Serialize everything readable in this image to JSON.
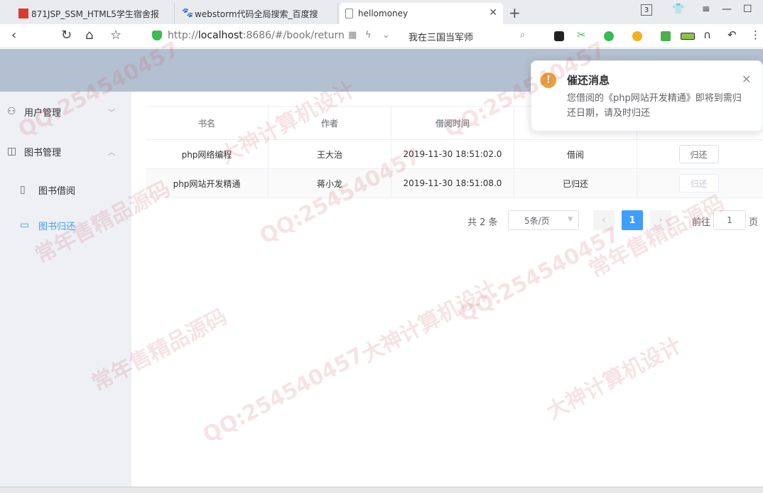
{
  "browser": {
    "tabs": [
      {
        "title": "871JSP_SSM_HTML5学生宿舍报",
        "icon": "red-square-icon"
      },
      {
        "title": "webstorm代码全局搜索_百度搜",
        "icon": "baidu-paw-icon"
      },
      {
        "title": "hellomoney",
        "icon": "page-icon"
      }
    ],
    "tab_count_badge": "3",
    "url_prefix": "http://",
    "url_host": "localhost",
    "url_rest": ":8686/#/book/return",
    "search_text": "我在三国当军师"
  },
  "sidebar": {
    "items": [
      {
        "label": "用户管理",
        "icon": "user-icon",
        "arrow": "chevron-down-icon"
      },
      {
        "label": "图书管理",
        "icon": "book-icon",
        "arrow": "chevron-up-icon"
      },
      {
        "label": "图书借阅",
        "icon": "book-open-icon"
      },
      {
        "label": "图书归还",
        "icon": "book-return-icon"
      }
    ]
  },
  "table": {
    "headers": [
      "书名",
      "作者",
      "借阅时间",
      "",
      ""
    ],
    "rows": [
      {
        "name": "php网络编程",
        "author": "王大治",
        "time": "2019-11-30 18:51:02.0",
        "status": "借阅",
        "action": "归还",
        "disabled": false
      },
      {
        "name": "php网站开发精通",
        "author": "蒋小龙",
        "time": "2019-11-30 18:51:08.0",
        "status": "已归还",
        "action": "归还",
        "disabled": true
      }
    ]
  },
  "pagination": {
    "total": "共 2 条",
    "page_size": "5条/页",
    "current": "1",
    "goto_label": "前往",
    "goto_value": "1",
    "goto_suffix": "页"
  },
  "notification": {
    "title": "催还消息",
    "message": "您借阅的《php网站开发精通》即将到需归还日期，请及时归还"
  },
  "watermark": {
    "texts": [
      "QQ:254540457",
      "大神计算机设计",
      "常年售精品源码"
    ]
  },
  "colors": {
    "accent": "#409eff",
    "header": "#b3c0d1",
    "sidebar": "#eef0f4",
    "warning": "#e6a23c"
  }
}
